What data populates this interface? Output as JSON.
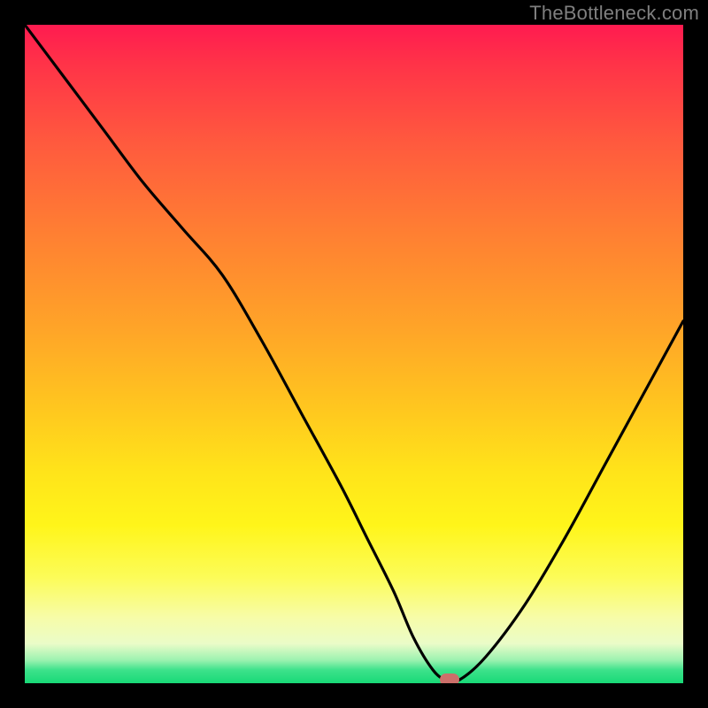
{
  "watermark": "TheBottleneck.com",
  "colors": {
    "page_bg": "#000000",
    "watermark": "#7f7f7f",
    "curve": "#000000",
    "marker": "#cc6f6a",
    "gradient_top": "#ff1b50",
    "gradient_mid": "#ffe41a",
    "gradient_bottom": "#18d977"
  },
  "chart_data": {
    "type": "line",
    "title": "",
    "xlabel": "",
    "ylabel": "",
    "xlim": [
      0,
      100
    ],
    "ylim": [
      0,
      100
    ],
    "grid": false,
    "legend": false,
    "series": [
      {
        "name": "bottleneck-curve",
        "x": [
          0,
          6,
          12,
          18,
          24,
          30,
          36,
          42,
          48,
          52,
          56,
          59,
          62,
          64,
          66,
          70,
          76,
          82,
          88,
          94,
          100
        ],
        "y": [
          100,
          92,
          84,
          76,
          69,
          62,
          52,
          41,
          30,
          22,
          14,
          7,
          2,
          0.5,
          0.5,
          4,
          12,
          22,
          33,
          44,
          55
        ]
      }
    ],
    "marker": {
      "x": 64.5,
      "y": 0.5
    },
    "flat_bottom": {
      "x_start": 62,
      "x_end": 66,
      "y": 0.5
    }
  }
}
